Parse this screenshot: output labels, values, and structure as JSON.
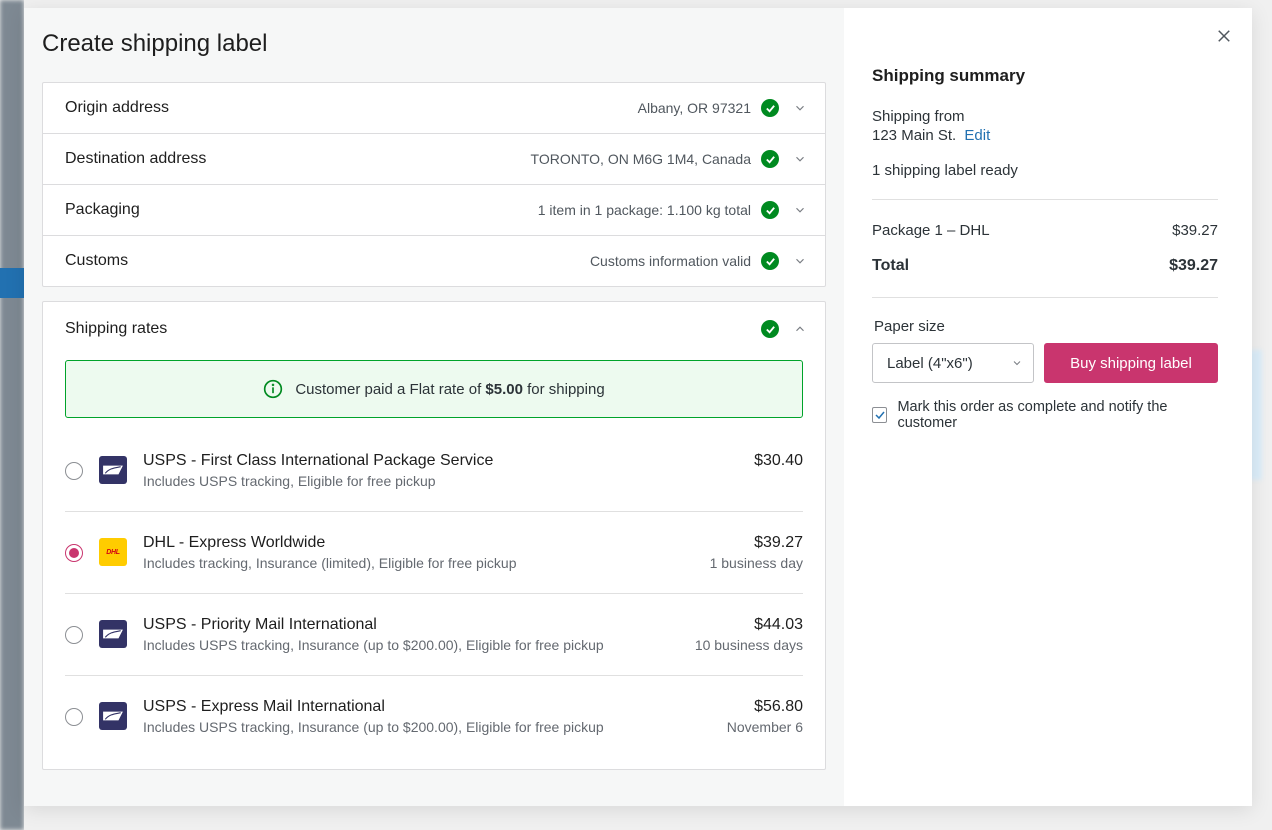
{
  "modal": {
    "title": "Create shipping label"
  },
  "sections": {
    "origin": {
      "title": "Origin address",
      "summary": "Albany, OR  97321"
    },
    "destination": {
      "title": "Destination address",
      "summary": "TORONTO, ON  M6G 1M4, Canada"
    },
    "packaging": {
      "title": "Packaging",
      "summary": "1 item in 1 package: 1.100 kg total"
    },
    "customs": {
      "title": "Customs",
      "summary": "Customs information valid"
    },
    "rates": {
      "title": "Shipping rates"
    }
  },
  "banner": {
    "prefix": "Customer paid a Flat rate of ",
    "amount": "$5.00",
    "suffix": " for shipping"
  },
  "rates": [
    {
      "carrier": "usps",
      "name": "USPS - First Class International Package Service",
      "desc": "Includes USPS tracking, Eligible for free pickup",
      "price": "$30.40",
      "eta": "",
      "selected": false
    },
    {
      "carrier": "dhl",
      "name": "DHL - Express Worldwide",
      "desc": "Includes tracking, Insurance (limited), Eligible for free pickup",
      "price": "$39.27",
      "eta": "1 business day",
      "selected": true
    },
    {
      "carrier": "usps",
      "name": "USPS - Priority Mail International",
      "desc": "Includes USPS tracking, Insurance (up to $200.00), Eligible for free pickup",
      "price": "$44.03",
      "eta": "10 business days",
      "selected": false
    },
    {
      "carrier": "usps",
      "name": "USPS - Express Mail International",
      "desc": "Includes USPS tracking, Insurance (up to $200.00), Eligible for free pickup",
      "price": "$56.80",
      "eta": "November 6",
      "selected": false
    }
  ],
  "summary": {
    "title": "Shipping summary",
    "from_label": "Shipping from",
    "from_address": "123 Main St.",
    "edit": "Edit",
    "ready": "1 shipping label ready",
    "line_label": "Package 1 – DHL",
    "line_price": "$39.27",
    "total_label": "Total",
    "total_price": "$39.27",
    "paper_label": "Paper size",
    "paper_value": "Label (4\"x6\")",
    "buy_button": "Buy shipping label",
    "mark_complete": "Mark this order as complete and notify the customer"
  },
  "carrier_labels": {
    "dhl": "DHL"
  }
}
